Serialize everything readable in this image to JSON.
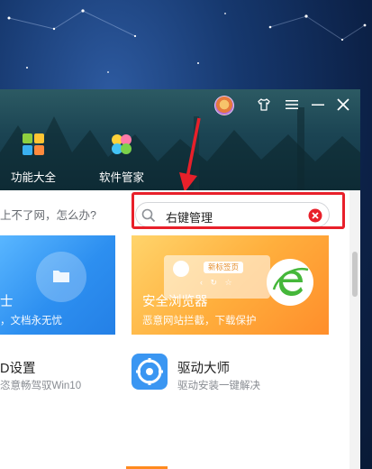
{
  "window": {
    "nav": [
      {
        "label": "功能大全",
        "icon": "app-grid-icon"
      },
      {
        "label": "软件管家",
        "icon": "software-manager-icon"
      }
    ],
    "controls": [
      "shirt-skin-icon",
      "menu-icon",
      "minimize-icon",
      "close-icon"
    ]
  },
  "tip": {
    "text": "上不了网，怎么办?"
  },
  "search": {
    "value": "右键管理",
    "icon": "search-icon",
    "clear_icon": "clear-icon"
  },
  "cards": {
    "left": {
      "title": "士",
      "subtitle": "，文档永无忧"
    },
    "right": {
      "title": "安全浏览器",
      "subtitle": "恶意网站拦截，下载保护",
      "mock_tab": "新标签页",
      "mock_nav": "‹ ↻ ☆"
    }
  },
  "tools": {
    "left": {
      "title": "D设置",
      "subtitle": "恣意畅驾驭Win10"
    },
    "right": {
      "title": "驱动大师",
      "subtitle": "驱动安装一键解决"
    }
  },
  "colors": {
    "highlight": "#e8202a",
    "accent_orange": "#ff8a1e",
    "accent_blue": "#2d8ff0"
  }
}
